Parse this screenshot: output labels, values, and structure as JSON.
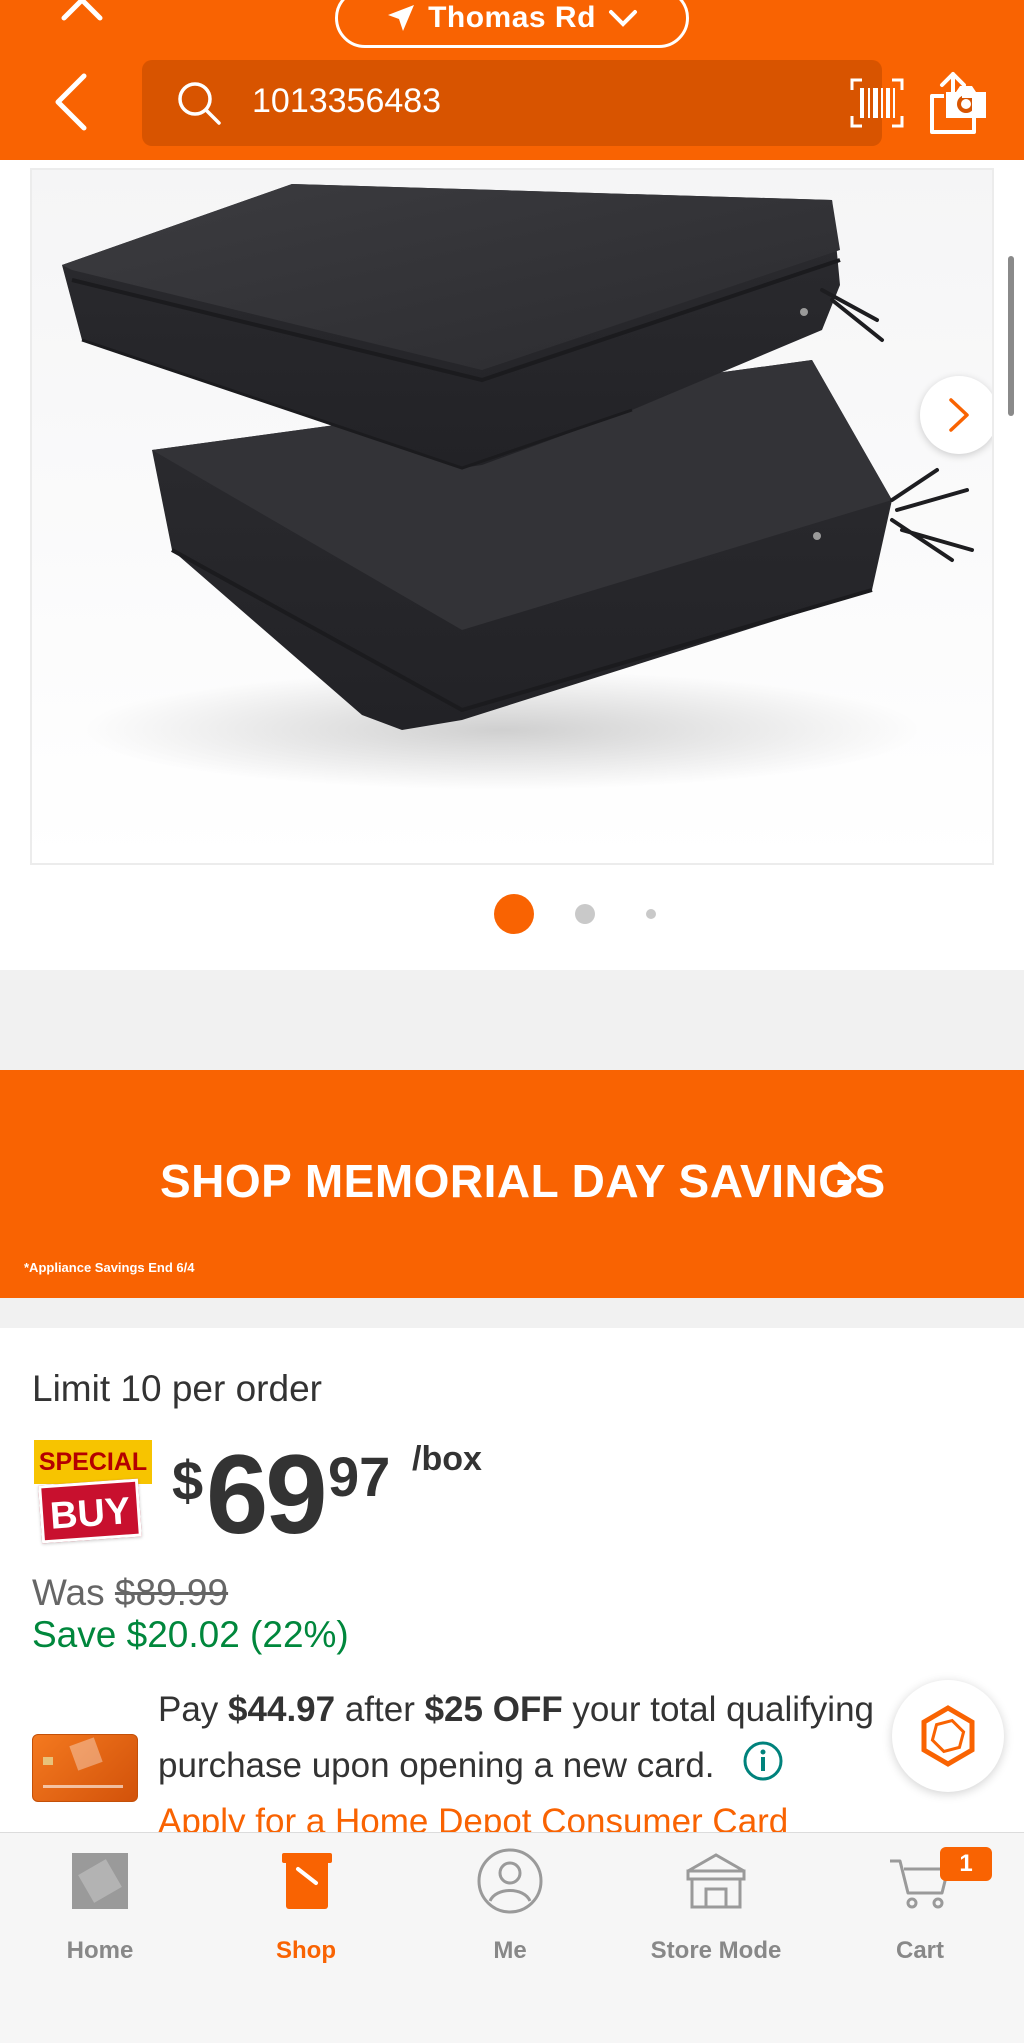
{
  "header": {
    "location_label": "Thomas Rd",
    "search_value": "1013356483"
  },
  "gallery": {
    "active_dot": 1,
    "dot_count": 3
  },
  "banner": {
    "cta": "SHOP MEMORIAL DAY SAVINGS",
    "fine_print": "*Appliance Savings End 6/4"
  },
  "pricing": {
    "limit": "Limit 10 per order",
    "badge_top": "SPECIAL",
    "badge_bottom": "BUY",
    "currency": "$",
    "dollars": "69",
    "cents": "97",
    "unit": "/box",
    "was_label": "Was ",
    "was_price": "$89.99",
    "save": "Save $20.02 (22%)"
  },
  "promo": {
    "pay_prefix": "Pay ",
    "pay_amount": "$44.97",
    "after": " after ",
    "off": "$25 OFF",
    "line1_suffix": " your total qualifying",
    "line2": "purchase upon opening a new card.",
    "apply": "Apply for a Home Depot Consumer Card"
  },
  "bottom_nav": {
    "items": [
      {
        "label": "Home",
        "icon": "home-depot-logo-icon"
      },
      {
        "label": "Shop",
        "icon": "paint-bucket-icon"
      },
      {
        "label": "Me",
        "icon": "user-icon"
      },
      {
        "label": "Store Mode",
        "icon": "store-icon"
      },
      {
        "label": "Cart",
        "icon": "cart-icon"
      }
    ],
    "cart_count": "1"
  },
  "colors": {
    "brand": "#f96302",
    "save_green": "#00873c",
    "badge_red": "#c8102e",
    "badge_yellow": "#f7c400"
  }
}
